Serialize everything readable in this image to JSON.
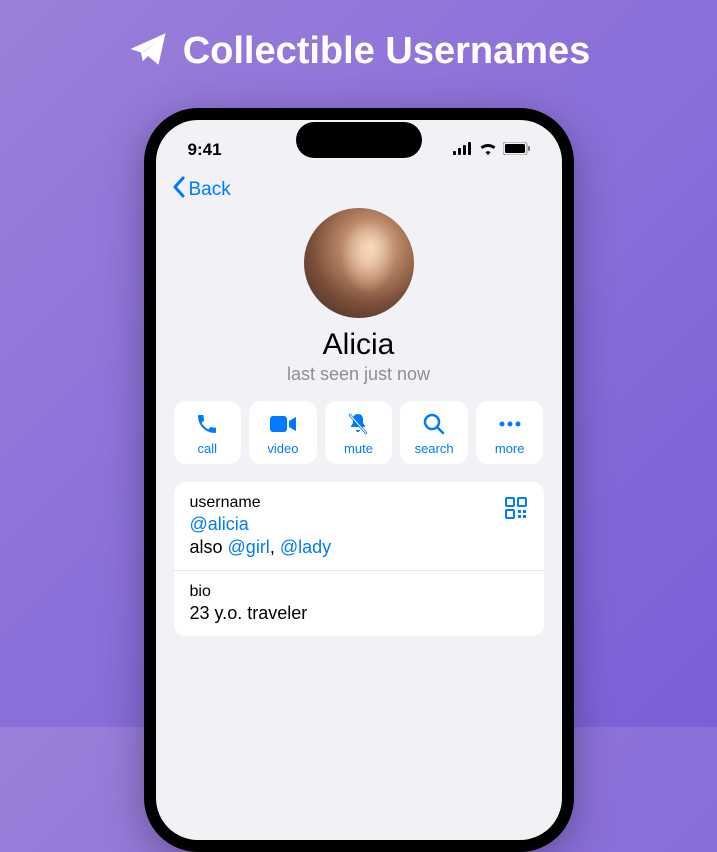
{
  "banner": {
    "title": "Collectible Usernames"
  },
  "statusBar": {
    "time": "9:41"
  },
  "nav": {
    "back": "Back"
  },
  "profile": {
    "name": "Alicia",
    "status": "last seen just now"
  },
  "actions": {
    "call": "call",
    "video": "video",
    "mute": "mute",
    "search": "search",
    "more": "more"
  },
  "info": {
    "usernameLabel": "username",
    "username": "@alicia",
    "alsoPrefix": "also ",
    "alsoUser1": "@girl",
    "alsoSep": ", ",
    "alsoUser2": "@lady",
    "bioLabel": "bio",
    "bio": "23 y.o. traveler"
  }
}
